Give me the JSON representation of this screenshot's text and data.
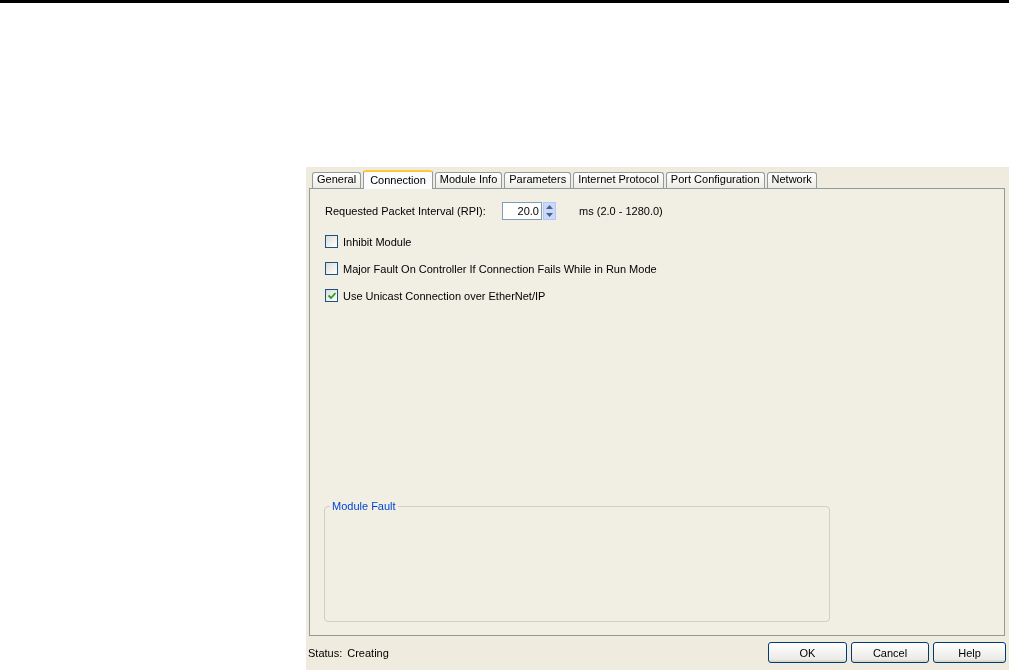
{
  "tabs": [
    {
      "label": "General",
      "selected": false
    },
    {
      "label": "Connection",
      "selected": true
    },
    {
      "label": "Module Info",
      "selected": false
    },
    {
      "label": "Parameters",
      "selected": false
    },
    {
      "label": "Internet Protocol",
      "selected": false
    },
    {
      "label": "Port Configuration",
      "selected": false
    },
    {
      "label": "Network",
      "selected": false
    }
  ],
  "rpi": {
    "label": "Requested Packet Interval (RPI):",
    "value": "20.0",
    "range": "ms (2.0 - 1280.0)"
  },
  "checkboxes": [
    {
      "label": "Inhibit Module",
      "checked": false
    },
    {
      "label": "Major Fault On Controller If Connection Fails While in Run Mode",
      "checked": false
    },
    {
      "label": "Use Unicast Connection over EtherNet/IP",
      "checked": true
    }
  ],
  "module_fault": {
    "title": "Module Fault"
  },
  "status": {
    "label": "Status:",
    "value": "Creating"
  },
  "buttons": [
    "OK",
    "Cancel",
    "Help"
  ]
}
